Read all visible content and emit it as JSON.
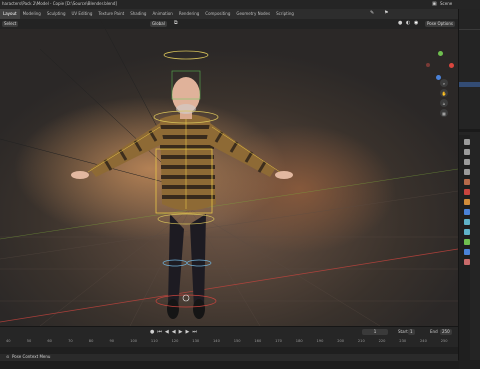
{
  "titlebar": {
    "file_path": "haracters\\Pack 2\\Model - Copie [D:\\Source\\Blender.blend]",
    "scene_label": "Scene"
  },
  "workspace_tabs": [
    "Layout",
    "Modeling",
    "Sculpting",
    "UV Editing",
    "Texture Paint",
    "Shading",
    "Animation",
    "Rendering",
    "Compositing",
    "Geometry Nodes",
    "Scripting"
  ],
  "viewport_header": {
    "select_label": "Select",
    "transform_label": "Global",
    "pose_options_label": "Pose Options"
  },
  "timeline": {
    "current_frame": "1",
    "start_label": "Start",
    "start_value": "1",
    "end_label": "End",
    "end_value": "250",
    "ruler_ticks": [
      "40",
      "50",
      "60",
      "70",
      "80",
      "90",
      "100",
      "110",
      "120",
      "130",
      "140",
      "150",
      "160",
      "170",
      "180",
      "190",
      "200",
      "210",
      "220",
      "230",
      "240",
      "250"
    ]
  },
  "statusbar": {
    "label": "Pose Context Menu"
  },
  "colors": {
    "accent": "#4772b3",
    "selected_bone": "#e8c547",
    "active_bone": "#5fcf5a",
    "axis_x": "#c8443e",
    "axis_y": "#7ba83a"
  }
}
